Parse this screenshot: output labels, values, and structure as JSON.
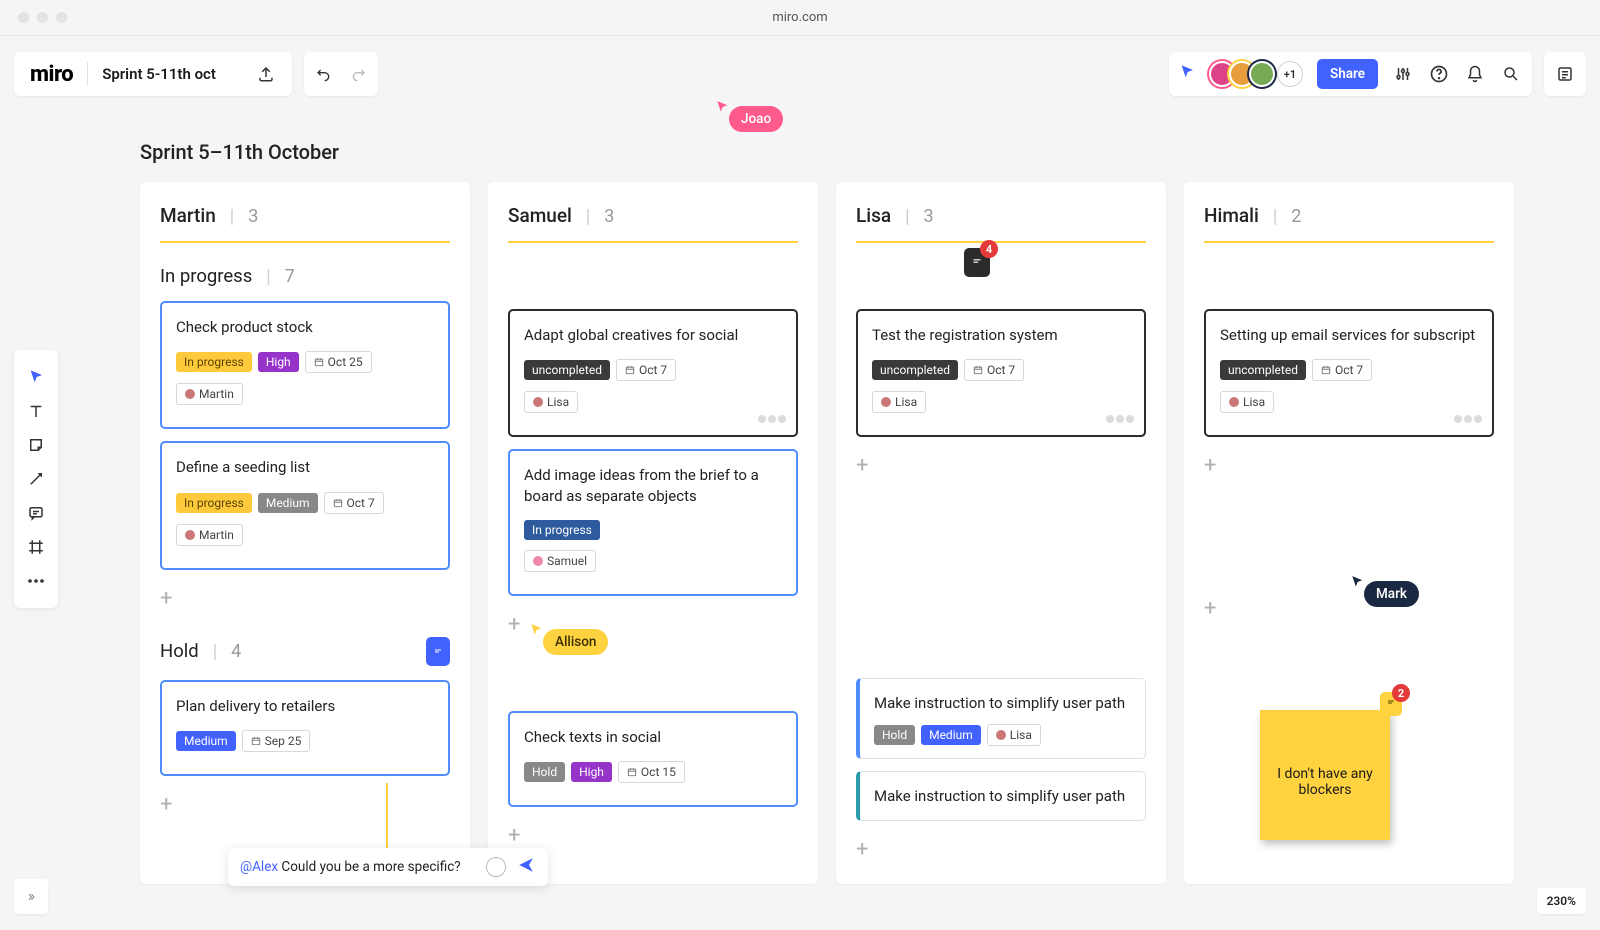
{
  "window": {
    "url": "miro.com"
  },
  "header": {
    "logo": "miro",
    "board_name": "Sprint 5-11th oct",
    "extra_avatars": "+1",
    "share_label": "Share"
  },
  "board": {
    "title": "Sprint 5–11th October"
  },
  "sections": {
    "in_progress": {
      "label": "In progress",
      "count": "7"
    },
    "hold": {
      "label": "Hold",
      "count": "4"
    }
  },
  "columns": [
    {
      "name": "Martin",
      "count": "3"
    },
    {
      "name": "Samuel",
      "count": "3"
    },
    {
      "name": "Lisa",
      "count": "3"
    },
    {
      "name": "Himali",
      "count": "2"
    }
  ],
  "cards": {
    "c0": {
      "title": "Check product stock",
      "status": "In progress",
      "priority": "High",
      "date": "Oct 25",
      "assignee": "Martin"
    },
    "c1": {
      "title": "Define a seeding list",
      "status": "In progress",
      "priority": "Medium",
      "date": "Oct 7",
      "assignee": "Martin"
    },
    "c2": {
      "title": "Plan delivery to retailers",
      "priority": "Medium",
      "date": "Sep 25"
    },
    "c3": {
      "title": "Adapt global creatives for social",
      "status": "uncompleted",
      "date": "Oct 7",
      "assignee": "Lisa"
    },
    "c4": {
      "title": "Add image ideas from the brief to a board as separate objects",
      "status": "In progress",
      "assignee": "Samuel"
    },
    "c5": {
      "title": "Check texts in social",
      "status": "Hold",
      "priority": "High",
      "date": "Oct 15"
    },
    "c6": {
      "title": "Test the registration system",
      "status": "uncompleted",
      "date": "Oct 7",
      "assignee": "Lisa"
    },
    "c7": {
      "title": "Make instruction to simplify user path",
      "status": "Hold",
      "priority": "Medium",
      "assignee": "Lisa"
    },
    "c8": {
      "title": "Make instruction to simplify user path"
    },
    "c9": {
      "title": "Setting up email services for subscript",
      "status": "uncompleted",
      "date": "Oct 7",
      "assignee": "Lisa"
    }
  },
  "cursors": {
    "joao": "Joao",
    "allison": "Allison",
    "mark": "Mark"
  },
  "badges": {
    "lisa_comment": "4",
    "sticky_comment": "2"
  },
  "sticky": {
    "text": "I don't have any blockers"
  },
  "comment": {
    "mention": "@Alex",
    "text": " Could you be a more specific?"
  },
  "zoom": "230%",
  "colors": {
    "brand_blue": "#4262ff",
    "accent_yellow": "#ffd23f",
    "cursor_pink": "#ff5a8c",
    "alert_red": "#e43a3a"
  }
}
